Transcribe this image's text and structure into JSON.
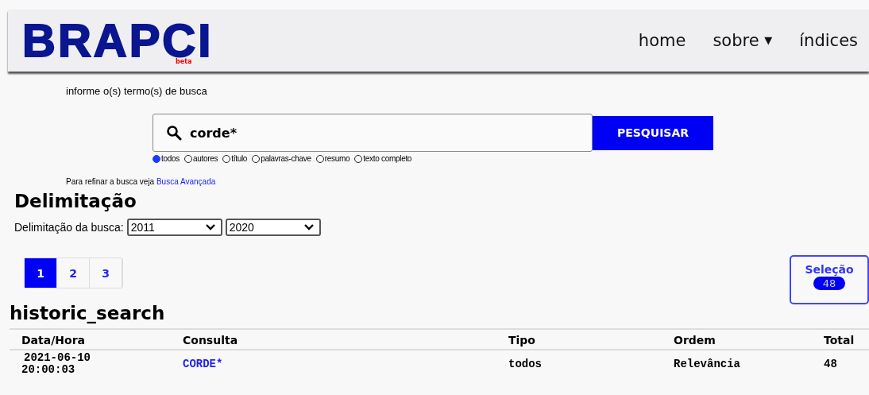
{
  "header": {
    "logo": "BRAPCI",
    "logo_badge": "beta",
    "nav": [
      {
        "label": "home",
        "kind": "link"
      },
      {
        "label": "sobre",
        "kind": "dropdown",
        "caret": "▼"
      },
      {
        "label": "índices",
        "kind": "link"
      }
    ]
  },
  "search": {
    "prompt": "informe o(s) termo(s) de busca",
    "value": "corde*",
    "button": "PESQUISAR",
    "scopes": [
      {
        "label": "todos",
        "selected": true
      },
      {
        "label": "autores",
        "selected": false
      },
      {
        "label": "título",
        "selected": false
      },
      {
        "label": "palavras-chave",
        "selected": false
      },
      {
        "label": "resumo",
        "selected": false
      },
      {
        "label": "texto completo",
        "selected": false
      }
    ],
    "refine_text": "Para refinar a busca veja",
    "refine_link": "Busca Avançada"
  },
  "delimitation": {
    "heading": "Delimitação",
    "label": "Delimitação da busca:",
    "from": "2011",
    "to": "2020"
  },
  "pagination": [
    {
      "label": "1",
      "selected": true
    },
    {
      "label": "2",
      "selected": false
    },
    {
      "label": "3",
      "selected": false
    }
  ],
  "selection": {
    "label": "Seleção",
    "count": "48"
  },
  "history": {
    "heading": "historic_search",
    "columns": [
      "Data/Hora",
      "Consulta",
      "Tipo",
      "Ordem",
      "Total"
    ],
    "rows": [
      {
        "date": "2021-06-10",
        "time": "20:00:03",
        "query": "CORDE*",
        "type": "todos",
        "order": "Relevância",
        "total": "48"
      }
    ]
  }
}
